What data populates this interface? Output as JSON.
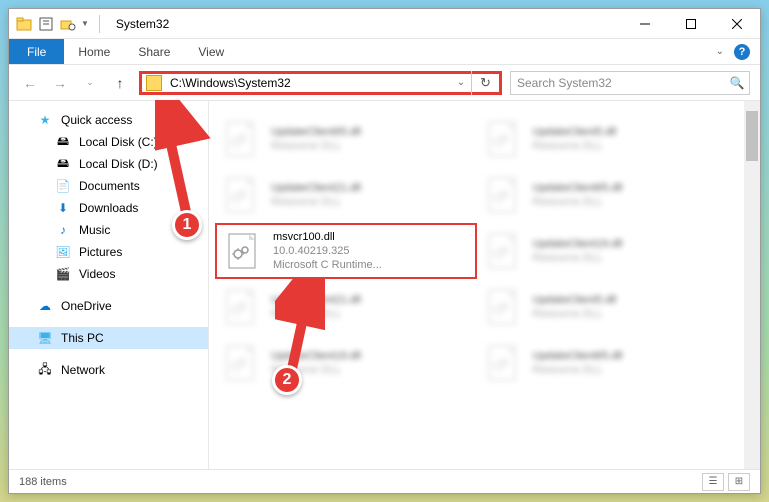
{
  "titlebar": {
    "title": "System32"
  },
  "ribbon": {
    "file": "File",
    "tabs": [
      "Home",
      "Share",
      "View"
    ]
  },
  "nav": {
    "address": "C:\\Windows\\System32",
    "search_placeholder": "Search System32"
  },
  "sidebar": {
    "quick_access": "Quick access",
    "items": [
      {
        "label": "Local Disk (C:)",
        "icon": "drive"
      },
      {
        "label": "Local Disk (D:)",
        "icon": "drive"
      },
      {
        "label": "Documents",
        "icon": "docs"
      },
      {
        "label": "Downloads",
        "icon": "downloads"
      },
      {
        "label": "Music",
        "icon": "music"
      },
      {
        "label": "Pictures",
        "icon": "pictures"
      },
      {
        "label": "Videos",
        "icon": "videos"
      }
    ],
    "onedrive": "OneDrive",
    "thispc": "This PC",
    "network": "Network"
  },
  "files": {
    "highlighted": {
      "name": "msvcr100.dll",
      "version": "10.0.40219.325",
      "desc": "Microsoft C Runtime..."
    },
    "blurred": [
      {
        "name": "UpdateClient65.dll",
        "sub": "Resource DLL"
      },
      {
        "name": "UpdateClient5.dll",
        "sub": "Resource DLL"
      },
      {
        "name": "UpdateClient21.dll",
        "sub": "Resource DLL"
      },
      {
        "name": "UpdateClient65.dll",
        "sub": "Resource DLL"
      },
      {
        "name": "UpdateClient19.dll",
        "sub": "Resource DLL"
      },
      {
        "name": "UpdateClient21.dll",
        "sub": "Resource DLL"
      },
      {
        "name": "UpdateClient5.dll",
        "sub": "Resource DLL"
      },
      {
        "name": "UpdateClient19.dll",
        "sub": "Resource DLL"
      },
      {
        "name": "UpdateClient65.dll",
        "sub": "Resource DLL"
      }
    ]
  },
  "status": {
    "count": "188 items"
  },
  "annotations": {
    "step1": "1",
    "step2": "2"
  }
}
